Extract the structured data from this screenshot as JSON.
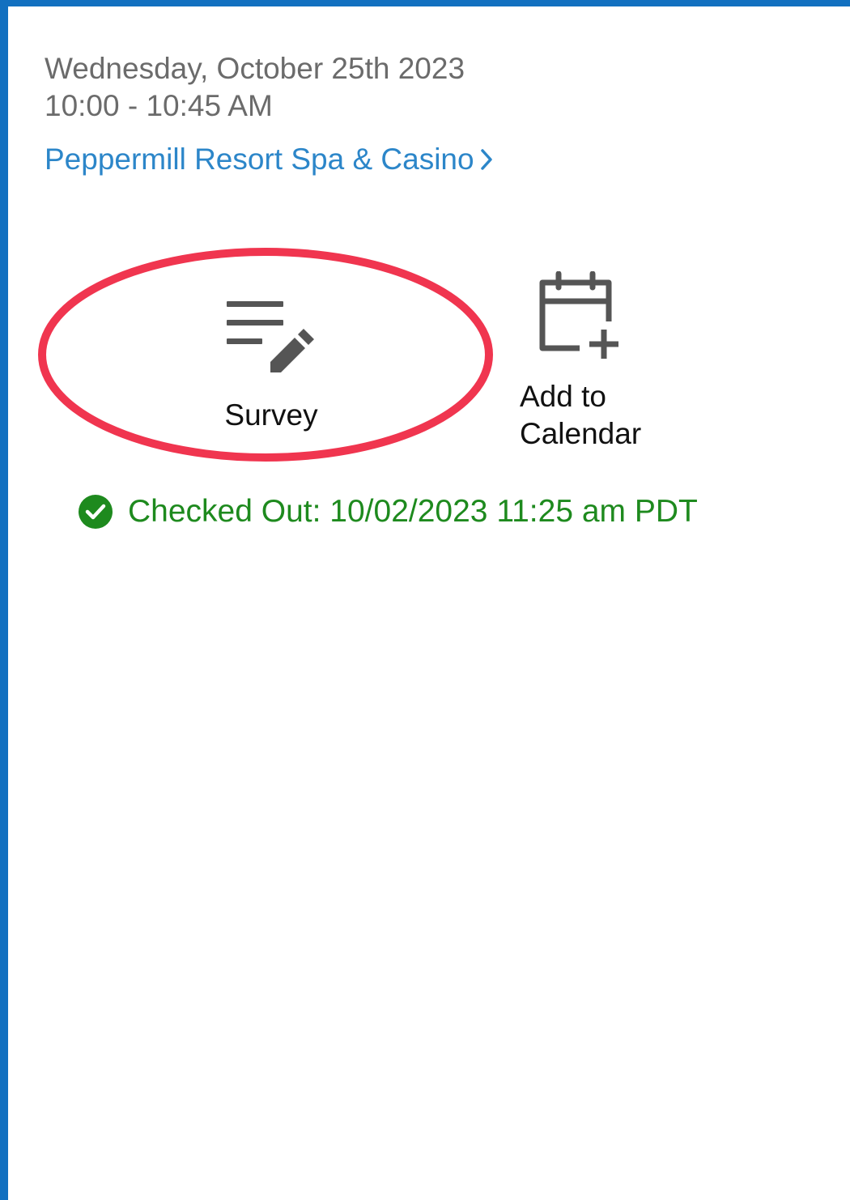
{
  "event": {
    "date": "Wednesday, October 25th 2023",
    "time": "10:00 - 10:45 AM",
    "venue": "Peppermill Resort Spa & Casino"
  },
  "actions": {
    "survey": {
      "label": "Survey",
      "icon": "survey-edit-icon"
    },
    "add_to_calendar": {
      "line1": "Add to",
      "line2": "Calendar",
      "icon": "calendar-add-icon"
    }
  },
  "status": {
    "text": "Checked Out: 10/02/2023 11:25 am PDT",
    "icon": "check-circle-icon",
    "color": "#1e8a1e"
  },
  "colors": {
    "frame": "#1270c0",
    "link": "#2c86c9",
    "highlight": "#f0354f"
  }
}
